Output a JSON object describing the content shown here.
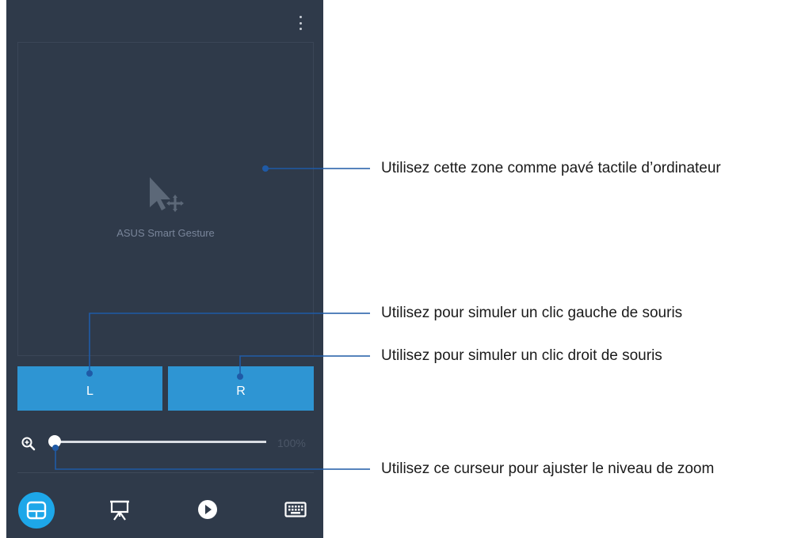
{
  "touchpad": {
    "label": "ASUS Smart Gesture"
  },
  "buttons": {
    "left_label": "L",
    "right_label": "R"
  },
  "zoom": {
    "value_text": "100%",
    "level_fraction": 0.0
  },
  "bottom_nav": {
    "items": [
      {
        "icon": "touchpad-icon",
        "selected": true
      },
      {
        "icon": "presentation-icon",
        "selected": false
      },
      {
        "icon": "media-play-icon",
        "selected": false
      },
      {
        "icon": "keyboard-icon",
        "selected": false
      }
    ]
  },
  "annotations": {
    "touchpad": "Utilisez cette zone comme pavé tactile d’ordinateur",
    "left_click": "Utilisez pour simuler un clic gauche de souris",
    "right_click": "Utilisez pour simuler un clic droit de souris",
    "zoom_slider": "Utilisez ce curseur pour ajuster le niveau de zoom"
  },
  "colors": {
    "panel_background": "#2f3a4a",
    "button_blue": "#2e95d3",
    "active_nav": "#1da7e9",
    "callout_line": "#1f5aa6"
  }
}
